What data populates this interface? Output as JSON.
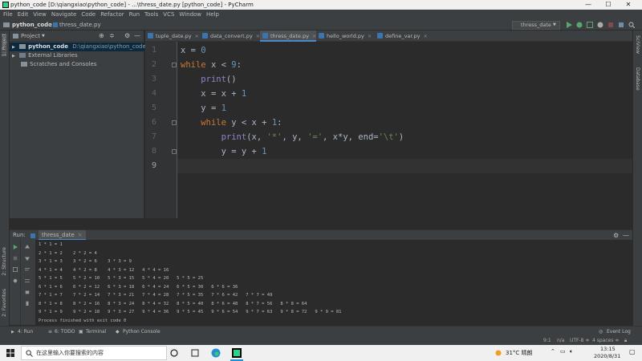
{
  "window": {
    "title": "python_code [D:\\qiangxiao\\python_code] - ...\\thress_date.py [python_code] - PyCharm",
    "minimize": "—",
    "maximize": "☐",
    "close": "✕"
  },
  "menu": [
    "File",
    "Edit",
    "View",
    "Navigate",
    "Code",
    "Refactor",
    "Run",
    "Tools",
    "VCS",
    "Window",
    "Help"
  ],
  "navbar": {
    "project": "python_code",
    "file": "thress_date.py"
  },
  "toolbar": {
    "run_config": "thress_date"
  },
  "left_strip": {
    "project": "1: Project",
    "structure": "2: Structure",
    "favorites": "2: Favorites"
  },
  "right_strip": {
    "sciview": "SciView",
    "database": "Database"
  },
  "project_panel": {
    "title": "Project",
    "items": [
      {
        "label": "python_code",
        "path": "D:\\qiangxiao\\python_code"
      },
      {
        "label": "External Libraries"
      },
      {
        "label": "Scratches and Consoles"
      }
    ]
  },
  "tabs": [
    {
      "label": "tuple_date.py"
    },
    {
      "label": "data_convert.py"
    },
    {
      "label": "thress_date.py"
    },
    {
      "label": "hello_world.py"
    },
    {
      "label": "define_var.py"
    }
  ],
  "editor": {
    "line_numbers": [
      "1",
      "2",
      "3",
      "4",
      "5",
      "6",
      "7",
      "8",
      "9"
    ],
    "lines": [
      {
        "indent": "",
        "parts": [
          [
            "t",
            "x = "
          ],
          [
            "num",
            "0"
          ]
        ]
      },
      {
        "indent": "",
        "parts": [
          [
            "kw",
            "while "
          ],
          [
            "t",
            "x < "
          ],
          [
            "num",
            "9"
          ],
          [
            "t",
            ":"
          ]
        ]
      },
      {
        "indent": "    ",
        "parts": [
          [
            "fn",
            "print"
          ],
          [
            "t",
            "()"
          ]
        ]
      },
      {
        "indent": "    ",
        "parts": [
          [
            "t",
            "x = x + "
          ],
          [
            "num",
            "1"
          ]
        ]
      },
      {
        "indent": "    ",
        "parts": [
          [
            "t",
            "y = "
          ],
          [
            "num",
            "1"
          ]
        ]
      },
      {
        "indent": "    ",
        "parts": [
          [
            "kw",
            "while "
          ],
          [
            "t",
            "y < x + "
          ],
          [
            "num",
            "1"
          ],
          [
            "t",
            ":"
          ]
        ]
      },
      {
        "indent": "        ",
        "parts": [
          [
            "fn",
            "print"
          ],
          [
            "t",
            "(x, "
          ],
          [
            "str",
            "'*'"
          ],
          [
            "t",
            ", y, "
          ],
          [
            "str",
            "'='"
          ],
          [
            "t",
            ", x*y, "
          ],
          [
            "t",
            "end="
          ],
          [
            "str",
            "'\\t'"
          ],
          [
            "t",
            ")"
          ]
        ]
      },
      {
        "indent": "        ",
        "parts": [
          [
            "t",
            "y = y + "
          ],
          [
            "num",
            "1"
          ]
        ]
      },
      {
        "indent": "",
        "parts": []
      }
    ]
  },
  "run_panel": {
    "label": "Run:",
    "tab": "thress_date",
    "output": [
      "1 * 1 = 1",
      "2 * 1 = 2    2 * 2 = 4",
      "3 * 1 = 3    3 * 2 = 6    3 * 3 = 9",
      "4 * 1 = 4    4 * 2 = 8    4 * 3 = 12   4 * 4 = 16",
      "5 * 1 = 5    5 * 2 = 10   5 * 3 = 15   5 * 4 = 20   5 * 5 = 25",
      "6 * 1 = 6    6 * 2 = 12   6 * 3 = 18   6 * 4 = 24   6 * 5 = 30   6 * 6 = 36",
      "7 * 1 = 7    7 * 2 = 14   7 * 3 = 21   7 * 4 = 28   7 * 5 = 35   7 * 6 = 42   7 * 7 = 49",
      "8 * 1 = 8    8 * 2 = 16   8 * 3 = 24   8 * 4 = 32   8 * 5 = 40   8 * 6 = 48   8 * 7 = 56   8 * 8 = 64",
      "9 * 1 = 9    9 * 2 = 18   9 * 3 = 27   9 * 4 = 36   9 * 5 = 45   9 * 6 = 54   9 * 7 = 63   9 * 8 = 72   9 * 9 = 81",
      "Process finished with exit code 0"
    ]
  },
  "bottom_tabs": [
    "4: Run",
    "6: TODO",
    "Terminal",
    "Python Console"
  ],
  "event_log": "Event Log",
  "status": {
    "position": "9:1",
    "na": "n/a",
    "encoding": "UTF-8 ≑",
    "indent": "4 spaces ≑"
  },
  "taskbar": {
    "search_placeholder": "在这里输入你要搜索的内容",
    "weather": "31°C 晴朗",
    "time": "13:15",
    "date": "2020/8/31"
  },
  "colors": {
    "accent": "#4a88c7",
    "keyword": "#cc7832",
    "number": "#6897bb",
    "string": "#6a8759",
    "builtin": "#8888c6"
  }
}
